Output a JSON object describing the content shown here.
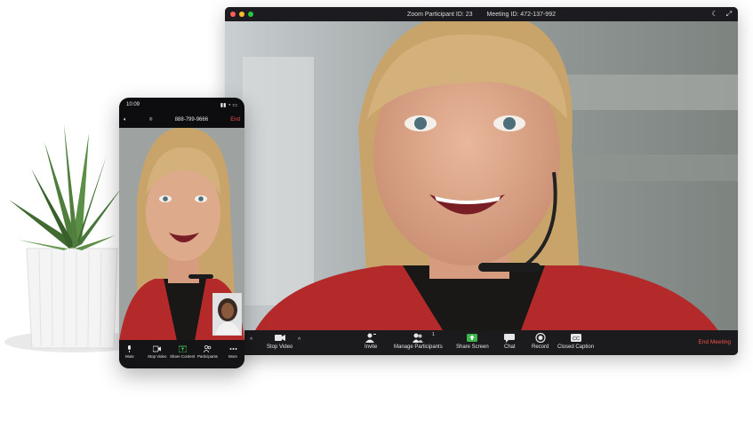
{
  "desktop": {
    "title_participant": "Zoom Participant ID: 23",
    "title_meeting": "Meeting ID: 472-137-992",
    "participant_count": "1",
    "toolbar": {
      "stop_video": "Stop Video",
      "invite": "Invite",
      "manage_participants": "Manage Participants",
      "share_screen": "Share Screen",
      "chat": "Chat",
      "record": "Record",
      "closed_caption": "Closed Caption",
      "end_meeting": "End Meeting"
    },
    "colors": {
      "share_green": "#3ab44a",
      "end_red": "#f1524b",
      "toolbar": "#1b1b1e"
    }
  },
  "phone": {
    "time": "10:09",
    "phone_number": "888-799-9666",
    "end_label": "End",
    "toolbar": {
      "mute": "Mute",
      "stop_video": "Stop Video",
      "share_content": "Share Content",
      "participants": "Participants",
      "more": "More"
    }
  }
}
